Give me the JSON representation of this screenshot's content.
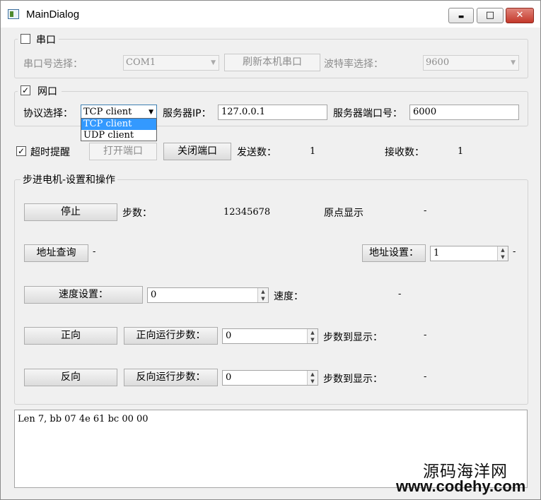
{
  "window": {
    "title": "MainDialog",
    "minimize_glyph": "▬",
    "maximize_glyph": "□",
    "close_glyph": "✕"
  },
  "serial": {
    "checkbox_label": "串口",
    "checked": false,
    "port_label": "串口号选择：",
    "port_value": "COM1",
    "refresh_button": "刷新本机串口",
    "baud_label": "波特率选择：",
    "baud_value": "9600"
  },
  "network": {
    "checkbox_label": "网口",
    "checked": true,
    "check_mark": "✓",
    "protocol_label": "协议选择：",
    "protocol_value": "TCP client",
    "protocol_options": [
      "TCP client",
      "UDP client"
    ],
    "server_ip_label": "服务器IP：",
    "server_ip_value": "127.0.0.1",
    "server_port_label": "服务器端口号：",
    "server_port_value": "6000"
  },
  "connection": {
    "timeout_label": "超时提醒",
    "timeout_checked": true,
    "check_mark": "✓",
    "open_button": "打开端口",
    "close_button": "关闭端口",
    "sent_label": "发送数：",
    "sent_value": "1",
    "recv_label": "接收数：",
    "recv_value": "1"
  },
  "stepper": {
    "group_title": "步进电机-设置和操作",
    "stop_button": "停止",
    "steps_label": "步数：",
    "steps_value": "12345678",
    "origin_label": "原点显示",
    "origin_value": "-",
    "addr_query_button": "地址查询",
    "addr_query_value": "-",
    "addr_set_button": "地址设置：",
    "addr_set_input": "1",
    "addr_set_value": "-",
    "speed_set_button": "速度设置：",
    "speed_input": "0",
    "speed_label": "速度：",
    "speed_value": "-",
    "forward_button": "正向",
    "forward_steps_button": "正向运行步数：",
    "forward_steps_input": "0",
    "forward_reached_label": "步数到显示：",
    "forward_reached_value": "-",
    "reverse_button": "反向",
    "reverse_steps_button": "反向运行步数：",
    "reverse_steps_input": "0",
    "reverse_reached_label": "步数到显示：",
    "reverse_reached_value": "-"
  },
  "log": {
    "text": "Len 7, bb 07 4e 61 bc 00 00"
  },
  "watermark": {
    "line1": "源码海洋网",
    "line2": "www.codehy.com"
  }
}
